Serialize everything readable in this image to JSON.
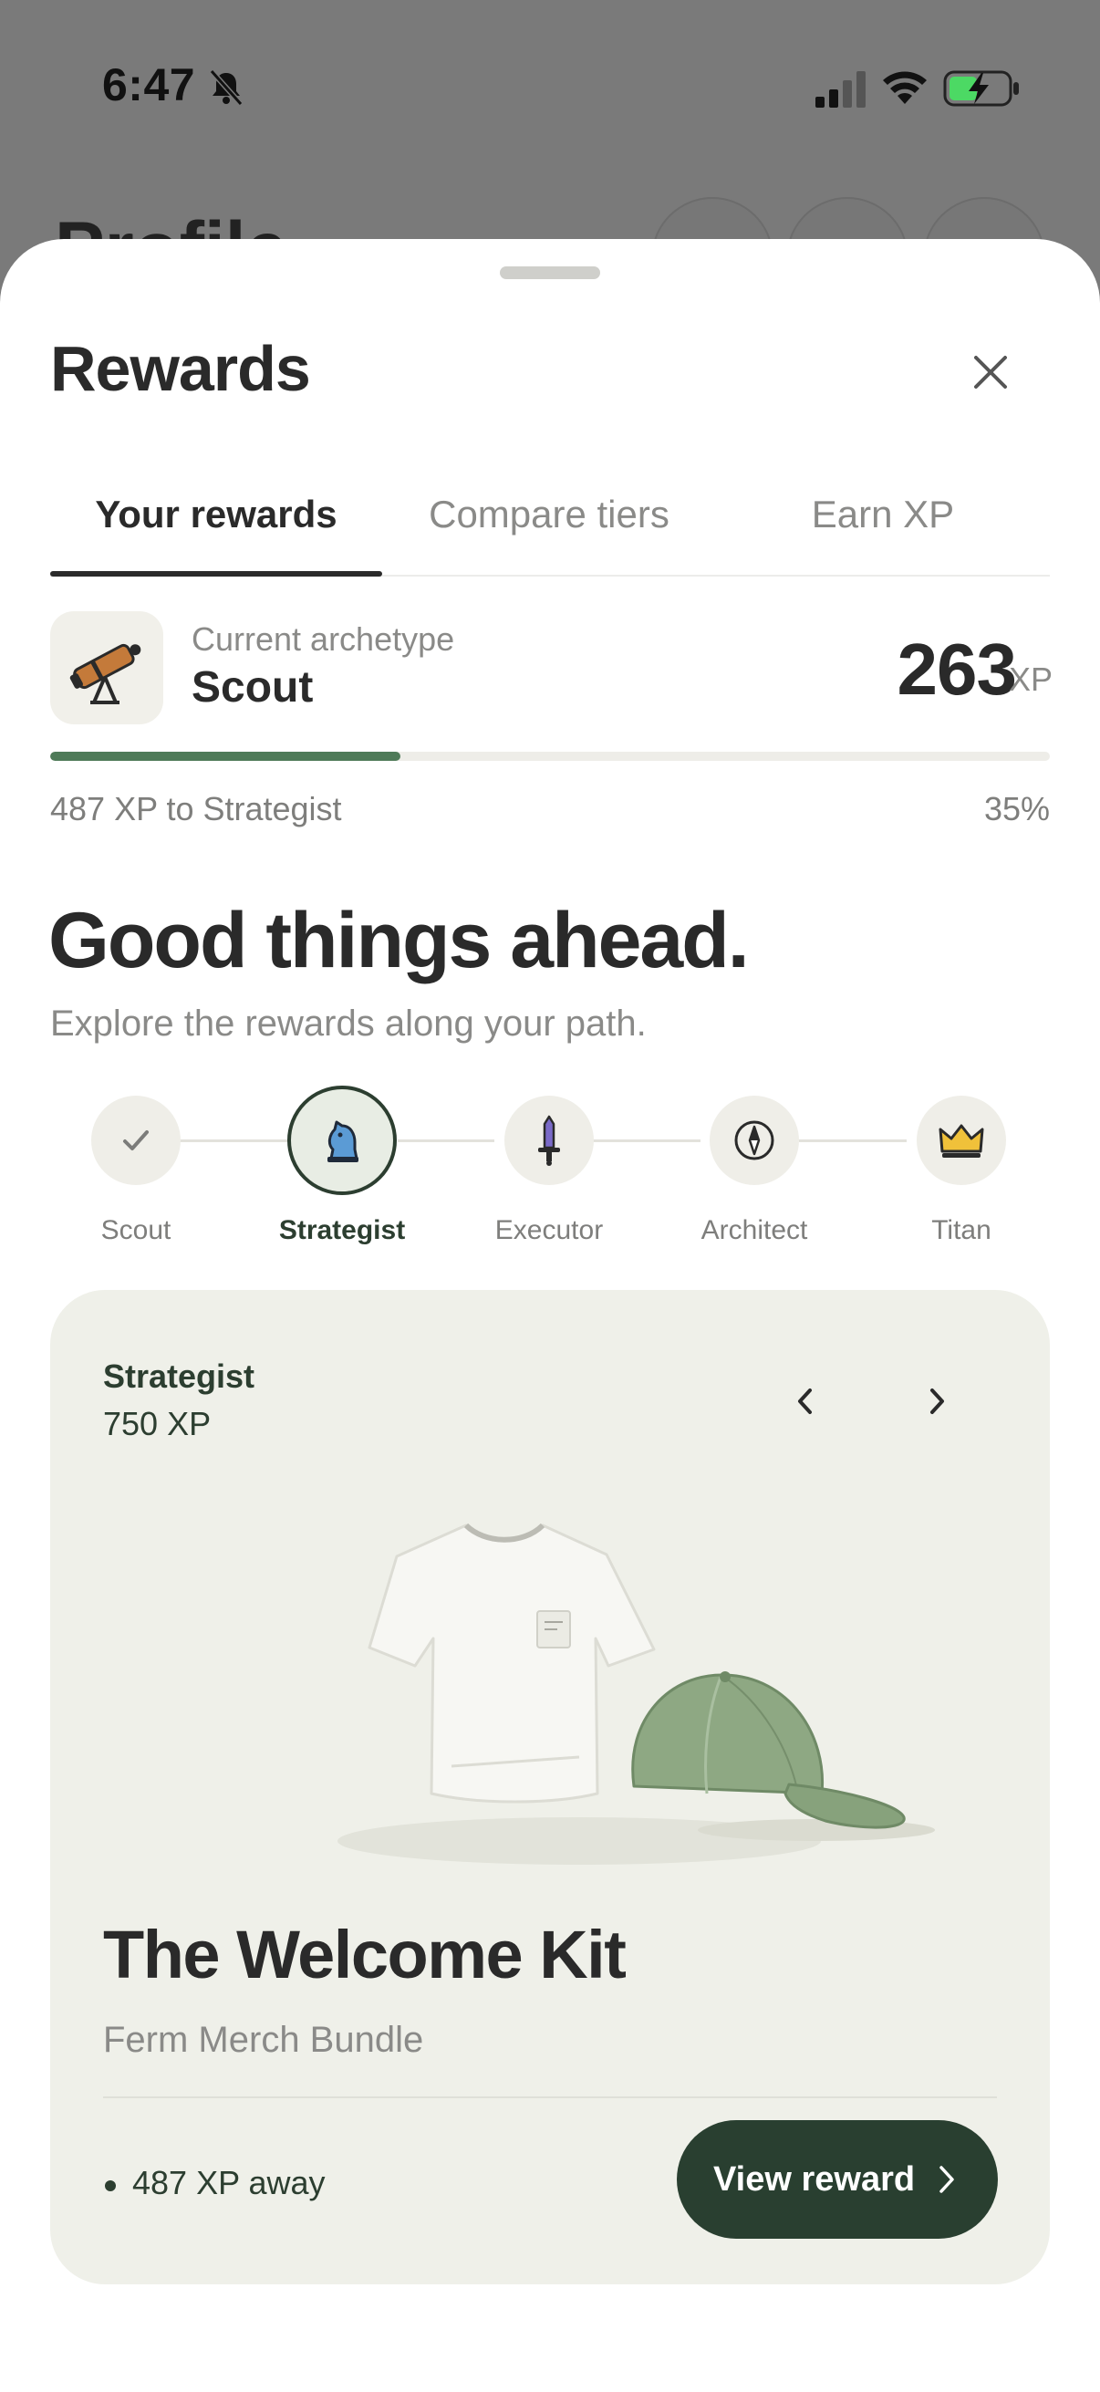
{
  "status": {
    "time": "6:47"
  },
  "sheet": {
    "title": "Rewards"
  },
  "tabs": [
    {
      "label": "Your rewards",
      "active": true
    },
    {
      "label": "Compare tiers",
      "active": false
    },
    {
      "label": "Earn XP",
      "active": false
    }
  ],
  "archetype": {
    "label": "Current archetype",
    "name": "Scout",
    "icon": "telescope-icon",
    "xp": "263",
    "xp_unit": "XP"
  },
  "progress": {
    "fraction": 0.35,
    "remaining_text": "487 XP to Strategist",
    "percent_text": "35%",
    "fill_color": "#4e7a58"
  },
  "headline": "Good things ahead.",
  "subline": "Explore the rewards along your path.",
  "tiers": [
    {
      "name": "Scout",
      "icon": "check-icon",
      "state": "completed"
    },
    {
      "name": "Strategist",
      "icon": "chess-knight-icon",
      "state": "selected"
    },
    {
      "name": "Executor",
      "icon": "sword-icon",
      "state": "locked"
    },
    {
      "name": "Architect",
      "icon": "compass-icon",
      "state": "locked"
    },
    {
      "name": "Titan",
      "icon": "crown-icon",
      "state": "locked"
    }
  ],
  "card": {
    "tier": "Strategist",
    "tier_xp": "750 XP",
    "title": "The Welcome Kit",
    "subtitle": "Ferm Merch Bundle",
    "away": "487 XP away",
    "button": "View reward",
    "illustration": "tshirt-and-cap-illustration"
  },
  "colors": {
    "accent_dark": "#293f30",
    "card_bg": "#eff0e9"
  }
}
